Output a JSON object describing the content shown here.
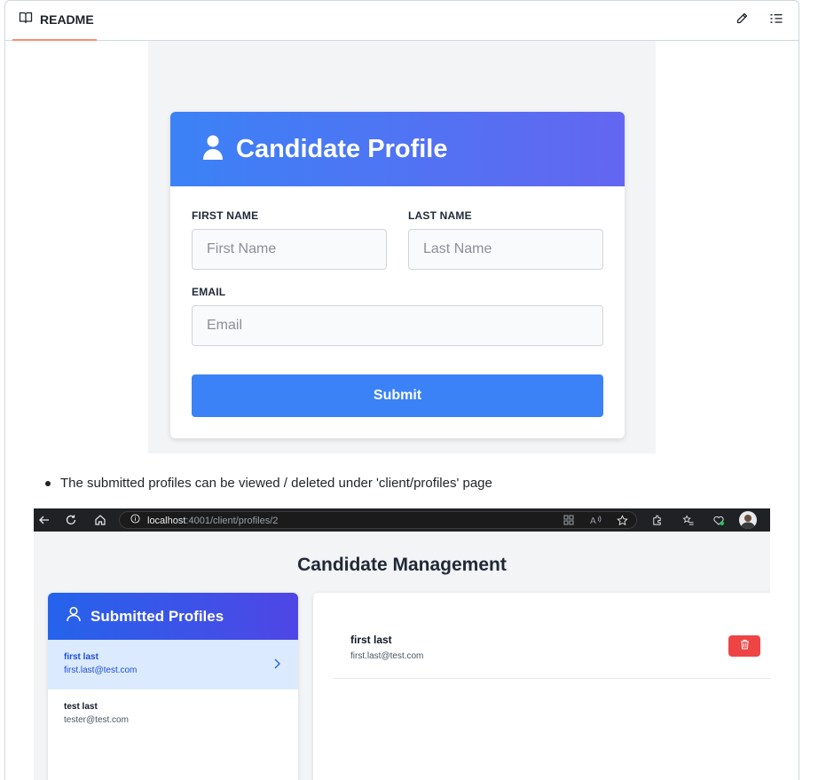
{
  "readme": {
    "tab_label": "README"
  },
  "candidate_form": {
    "title": "Candidate Profile",
    "first_name_label": "FIRST NAME",
    "first_name_placeholder": "First Name",
    "last_name_label": "LAST NAME",
    "last_name_placeholder": "Last Name",
    "email_label": "EMAIL",
    "email_placeholder": "Email",
    "submit_label": "Submit"
  },
  "bullet_text": "The submitted profiles can be viewed / deleted under 'client/profiles' page",
  "browser": {
    "url_host": "localhost",
    "url_path": ":4001/client/profiles/2"
  },
  "management": {
    "title": "Candidate Management",
    "panel_title": "Submitted Profiles",
    "profiles": [
      {
        "name": "first last",
        "email": "first.last@test.com"
      },
      {
        "name": "test last",
        "email": "tester@test.com"
      }
    ],
    "detail": {
      "name": "first last",
      "email": "first.last@test.com"
    }
  },
  "colors": {
    "accent_blue": "#3b82f6",
    "gradient_end": "#6366f1",
    "delete_red": "#ef4444",
    "tab_underline": "#fd8c73"
  }
}
